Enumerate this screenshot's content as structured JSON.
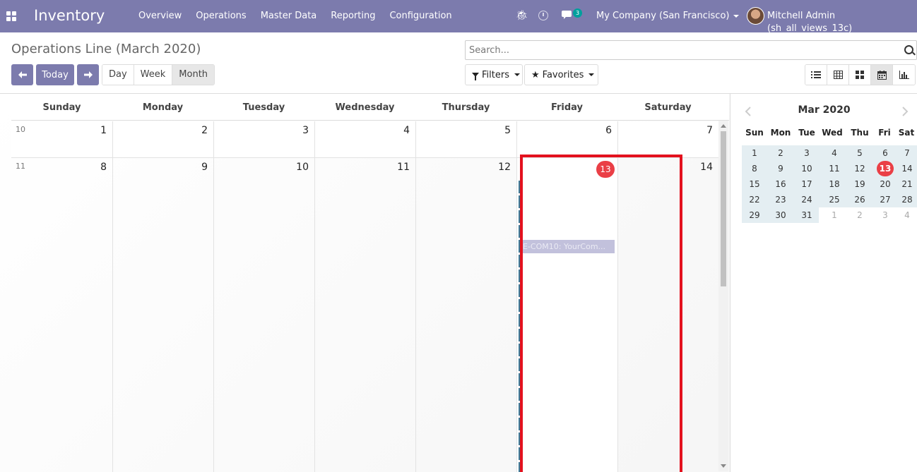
{
  "navbar": {
    "brand": "Inventory",
    "menu": [
      "Overview",
      "Operations",
      "Master Data",
      "Reporting",
      "Configuration"
    ],
    "chat_count": "3",
    "company": "My Company (San Francisco)",
    "user": "Mitchell Admin (sh_all_views_13c)"
  },
  "control": {
    "title": "Operations Line (March 2020)",
    "today_label": "Today",
    "scales": [
      "Day",
      "Week",
      "Month"
    ],
    "active_scale": "Month",
    "search_placeholder": "Search...",
    "filters_label": "Filters",
    "favorites_label": "Favorites",
    "active_view": "calendar"
  },
  "calendar": {
    "day_headers": [
      "Sunday",
      "Monday",
      "Tuesday",
      "Wednesday",
      "Thursday",
      "Friday",
      "Saturday"
    ],
    "weeks": [
      {
        "week": "10",
        "days": [
          "1",
          "2",
          "3",
          "4",
          "5",
          "6",
          "7"
        ]
      },
      {
        "week": "11",
        "days": [
          "8",
          "9",
          "10",
          "11",
          "12",
          "13",
          "14"
        ]
      }
    ],
    "today": "13",
    "event_label": "E-COM10: YourCom..."
  },
  "mini_calendar": {
    "title": "Mar 2020",
    "dow": [
      "Sun",
      "Mon",
      "Tue",
      "Wed",
      "Thu",
      "Fri",
      "Sat"
    ],
    "rows": [
      [
        "1",
        "2",
        "3",
        "4",
        "5",
        "6",
        "7"
      ],
      [
        "8",
        "9",
        "10",
        "11",
        "12",
        "13",
        "14"
      ],
      [
        "15",
        "16",
        "17",
        "18",
        "19",
        "20",
        "21"
      ],
      [
        "22",
        "23",
        "24",
        "25",
        "26",
        "27",
        "28"
      ],
      [
        "29",
        "30",
        "31",
        "1",
        "2",
        "3",
        "4"
      ]
    ],
    "today": "13"
  },
  "colors": {
    "navbar": "#7c7bad",
    "today_badge": "#ea3f46",
    "event_bar": "#3d7d99",
    "highlight": "#e3111e"
  }
}
